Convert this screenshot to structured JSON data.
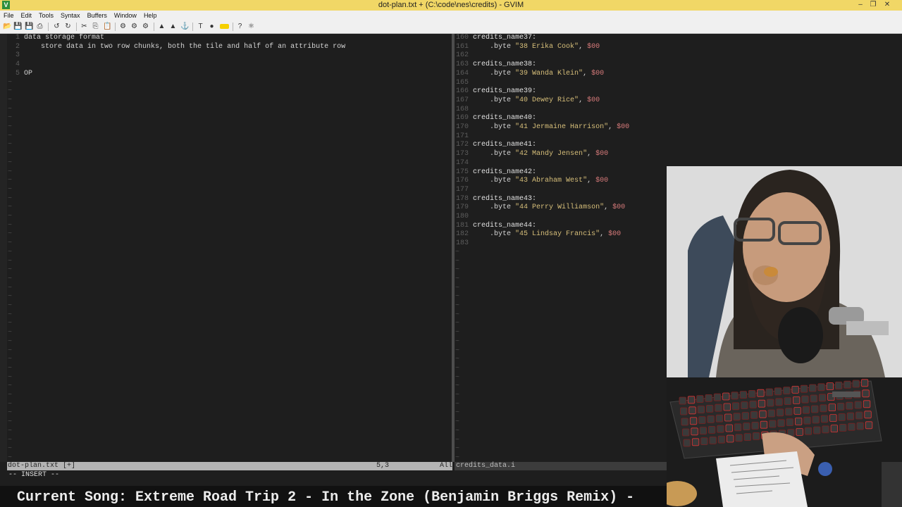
{
  "window": {
    "title": "dot-plan.txt + (C:\\code\\nes\\credits) - GVIM",
    "app_icon": "vim-icon"
  },
  "menu": [
    "File",
    "Edit",
    "Tools",
    "Syntax",
    "Buffers",
    "Window",
    "Help"
  ],
  "left_pane": {
    "lines": [
      {
        "num": "1",
        "text": "data storage format"
      },
      {
        "num": "2",
        "text": "    store data in two row chunks, both the tile and half of an attribute row"
      },
      {
        "num": "3",
        "text": ""
      },
      {
        "num": "4",
        "text": ""
      },
      {
        "num": "5",
        "text": "OP"
      }
    ]
  },
  "right_pane": {
    "lines": [
      {
        "num": "160",
        "label": "credits_name37:"
      },
      {
        "num": "161",
        "byte": ".byte ",
        "str": "\"38 Erika Cook\"",
        "val": "$00"
      },
      {
        "num": "162"
      },
      {
        "num": "163",
        "label": "credits_name38:"
      },
      {
        "num": "164",
        "byte": ".byte ",
        "str": "\"39 Wanda Klein\"",
        "val": "$00"
      },
      {
        "num": "165"
      },
      {
        "num": "166",
        "label": "credits_name39:"
      },
      {
        "num": "167",
        "byte": ".byte ",
        "str": "\"40 Dewey Rice\"",
        "val": "$00"
      },
      {
        "num": "168"
      },
      {
        "num": "169",
        "label": "credits_name40:"
      },
      {
        "num": "170",
        "byte": ".byte ",
        "str": "\"41 Jermaine Harrison\"",
        "val": "$00"
      },
      {
        "num": "171"
      },
      {
        "num": "172",
        "label": "credits_name41:"
      },
      {
        "num": "173",
        "byte": ".byte ",
        "str": "\"42 Mandy Jensen\"",
        "val": "$00"
      },
      {
        "num": "174"
      },
      {
        "num": "175",
        "label": "credits_name42:"
      },
      {
        "num": "176",
        "byte": ".byte ",
        "str": "\"43 Abraham West\"",
        "val": "$00"
      },
      {
        "num": "177"
      },
      {
        "num": "178",
        "label": "credits_name43:"
      },
      {
        "num": "179",
        "byte": ".byte ",
        "str": "\"44 Perry Williamson\"",
        "val": "$00"
      },
      {
        "num": "180"
      },
      {
        "num": "181",
        "label": "credits_name44:"
      },
      {
        "num": "182",
        "byte": ".byte ",
        "str": "\"45 Lindsay Francis\"",
        "val": "$00"
      },
      {
        "num": "183"
      }
    ]
  },
  "status": {
    "left_file": "dot-plan.txt [+]",
    "left_pos": "5,3",
    "left_scroll": "All",
    "right_file": "credits_data.i"
  },
  "cmdline": "-- INSERT --",
  "song": "Current Song: Extreme Road Trip 2 - In the Zone (Benjamin Briggs Remix) -",
  "colors": {
    "titlebar": "#f1d766",
    "string": "#d7bf7a",
    "number": "#d87b7b",
    "linenumber": "#5c5c5c",
    "background": "#1e1e1e"
  }
}
